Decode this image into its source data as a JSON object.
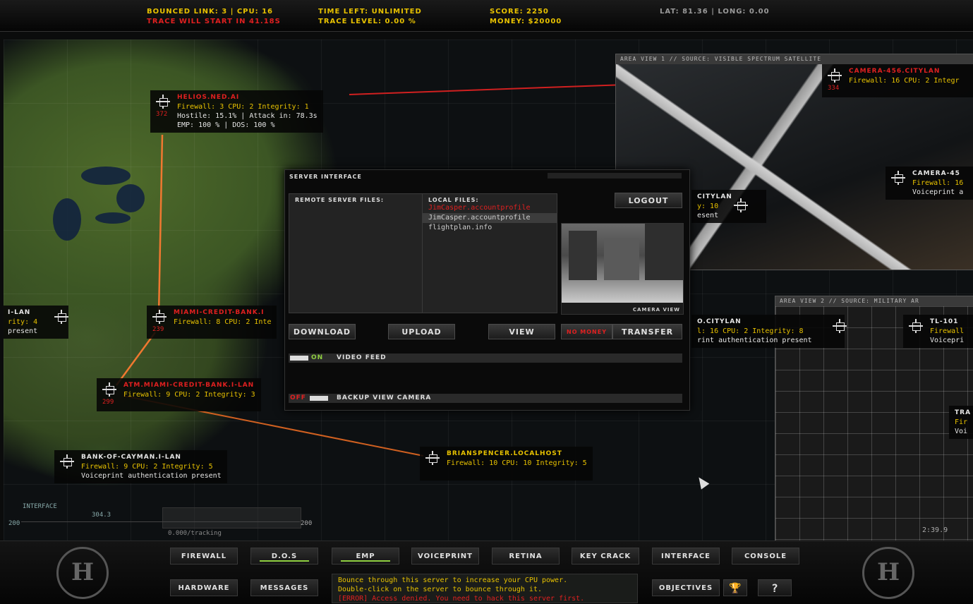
{
  "hud": {
    "bounced_link": "Bounced link: 3 | CPU: 16",
    "trace_start": "Trace will start in 41.18s",
    "time_left": "Time left: unlimited",
    "trace_level": "Trace level: 0.00 %",
    "score": "Score: 2250",
    "money": "Money: $20000",
    "latlong": "LAT: 81.36 | LONG: 0.00"
  },
  "nodes": [
    {
      "id": "helios",
      "title": "HELIOS.NED.AI",
      "title_color": "#e02020",
      "num": "372",
      "lines": [
        "Firewall: 3 CPU: 2 Integrity: 1",
        "Hostile: 15.1% | Attack in: 78.3s",
        "EMP: 100 % | DOS: 100 %"
      ]
    },
    {
      "id": "miami-bank",
      "title": "MIAMI-CREDIT-BANK.I",
      "title_color": "#e02020",
      "num": "239",
      "lines": [
        "Firewall: 8 CPU: 2 Inte"
      ]
    },
    {
      "id": "atm",
      "title": "ATM.MIAMI-CREDIT-BANK.I-LAN",
      "title_color": "#e02020",
      "num": "299",
      "lines": [
        "Firewall: 9 CPU: 2 Integrity: 3"
      ]
    },
    {
      "id": "cayman",
      "title": "BANK-OF-CAYMAN.I-LAN",
      "title_color": "#e6e6e6",
      "num": "",
      "lines": [
        "Firewall: 9 CPU: 2 Integrity: 5",
        "Voiceprint authentication present"
      ]
    },
    {
      "id": "brian",
      "title": "BRIANSPENCER.LOCALHOST",
      "title_color": "#e8c200",
      "num": "",
      "lines": [
        "Firewall: 10 CPU: 10 Integrity: 5"
      ]
    },
    {
      "id": "left-lan",
      "title": "I-LAN",
      "title_color": "#e6e6e6",
      "num": "",
      "lines": [
        "rity: 4",
        "present"
      ]
    },
    {
      "id": "camera456",
      "title": "CAMERA-456.CITYLAN",
      "title_color": "#e02020",
      "num": "334",
      "lines": [
        "Firewall: 16 CPU: 2 Integr"
      ]
    },
    {
      "id": "camera45",
      "title": "CAMERA-45",
      "title_color": "#e6e6e6",
      "num": "",
      "lines": [
        "Firewall: 16",
        "Voiceprint a"
      ]
    },
    {
      "id": "citylan",
      "title": "CITYLAN",
      "title_color": "#e6e6e6",
      "num": "",
      "lines": [
        "y: 10",
        "esent"
      ]
    },
    {
      "id": "o-citylan",
      "title": "O.CITYLAN",
      "title_color": "#e6e6e6",
      "num": "",
      "lines": [
        "l: 16 CPU: 2 Integrity: 8",
        "rint authentication present"
      ]
    },
    {
      "id": "tl101",
      "title": "TL-101",
      "title_color": "#e6e6e6",
      "num": "",
      "lines": [
        "Firewall",
        "Voicepri"
      ]
    },
    {
      "id": "tra",
      "title": "TRA",
      "title_color": "#e6e6e6",
      "num": "",
      "lines": [
        "Fir",
        "Voi"
      ]
    }
  ],
  "area_view_1": "AREA VIEW 1 // SOURCE: VISIBLE SPECTRUM SATELLITE",
  "area_view_2": "AREA VIEW 2 // SOURCE: MILITARY AR",
  "server": {
    "title": "Server interface",
    "remote_label": "Remote server files:",
    "local_label": "Local files:",
    "local_files": [
      {
        "name": "JimCasper.accountprofile",
        "color": "#e02020"
      },
      {
        "name": "JimCasper.accountprofile",
        "color": "#cfcfcf"
      },
      {
        "name": "flightplan.info",
        "color": "#cfcfcf"
      }
    ],
    "logout": "LOGOUT",
    "camera_view": "Camera view",
    "download": "DOWNLOAD",
    "upload": "UPLOAD",
    "view": "VIEW",
    "no_money": "No money",
    "transfer": "TRANSFER",
    "video_feed_state": "ON",
    "video_feed": "Video feed",
    "backup_state": "OFF",
    "backup": "Backup view camera"
  },
  "graph": {
    "interface": "INTERFACE",
    "value": "304.3",
    "low": "200",
    "high": "200",
    "tracking": "0.000/tracking"
  },
  "timer": "2:39.9",
  "toolbar": {
    "row1": [
      "FIREWALL",
      "D.O.S",
      "EMP",
      "VOICEPRINT",
      "RETINA",
      "KEY CRACK",
      "INTERFACE",
      "CONSOLE"
    ],
    "hardware": "HARDWARE",
    "messages": "MESSAGES",
    "objectives": "OBJECTIVES",
    "trophy_glyph": "🏆",
    "help": "?"
  },
  "messages": [
    {
      "text": "Bounce through this server to increase your CPU power.",
      "color": "#e8c200"
    },
    {
      "text": "Double-click on the server to bounce through it.",
      "color": "#e8c200"
    },
    {
      "text": "[ERROR] Access denied. You need to hack this server first.",
      "color": "#e02020"
    }
  ],
  "logo_glyph": "H"
}
